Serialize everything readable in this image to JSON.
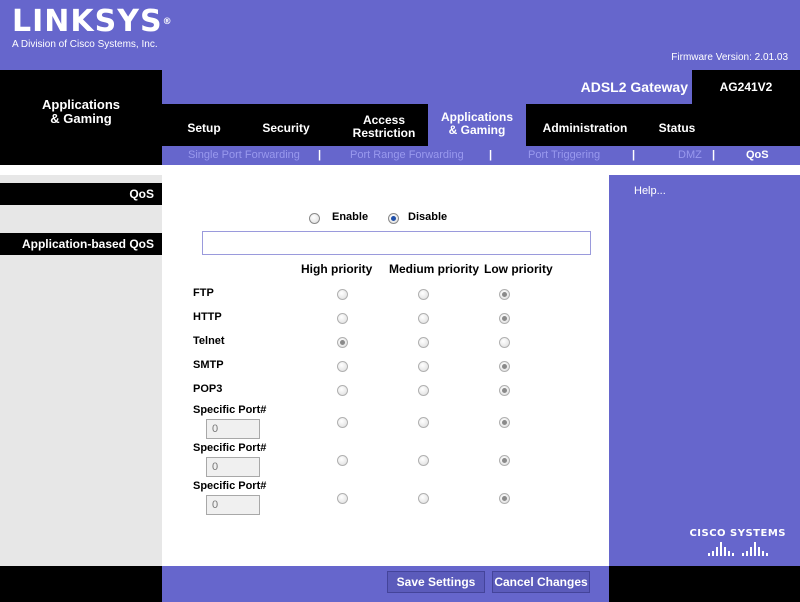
{
  "brand": {
    "logo": "LINKSYS",
    "registered": "®",
    "subtitle": "A Division of Cisco Systems, Inc.",
    "firmware": "Firmware Version: 2.01.03"
  },
  "section_title": "Applications\n& Gaming",
  "gateway": {
    "name": "ADSL2 Gateway",
    "model": "AG241V2"
  },
  "tabs": [
    {
      "label": "Setup"
    },
    {
      "label": "Security"
    },
    {
      "label": "Access\nRestriction"
    },
    {
      "label": "Applications\n& Gaming",
      "active": true
    },
    {
      "label": "Administration"
    },
    {
      "label": "Status"
    }
  ],
  "subtabs": [
    {
      "label": "Single Port Forwarding"
    },
    {
      "label": "Port Range Forwarding"
    },
    {
      "label": "Port Triggering"
    },
    {
      "label": "DMZ"
    },
    {
      "label": "QoS",
      "active": true
    }
  ],
  "subtab_separator": "|",
  "left_sections": [
    "QoS",
    "Application-based QoS"
  ],
  "qos": {
    "enable_label": "Enable",
    "disable_label": "Disable",
    "selected": "Disable"
  },
  "priority_headers": [
    "High priority",
    "Medium priority",
    "Low priority"
  ],
  "rows": [
    {
      "label": "FTP",
      "priority": "Low"
    },
    {
      "label": "HTTP",
      "priority": "Low"
    },
    {
      "label": "Telnet",
      "priority": "High"
    },
    {
      "label": "SMTP",
      "priority": "Low"
    },
    {
      "label": "POP3",
      "priority": "Low"
    },
    {
      "label": "Specific Port#",
      "port": "0",
      "priority": "Low"
    },
    {
      "label": "Specific Port#",
      "port": "0",
      "priority": "Low"
    },
    {
      "label": "Specific Port#",
      "port": "0",
      "priority": "Low"
    }
  ],
  "help": "Help...",
  "cisco": "CISCO SYSTEMS",
  "buttons": {
    "save": "Save Settings",
    "cancel": "Cancel Changes"
  },
  "colors": {
    "brand_purple": "#6666cc",
    "black": "#000000",
    "subtab_inactive": "#9999ee"
  }
}
